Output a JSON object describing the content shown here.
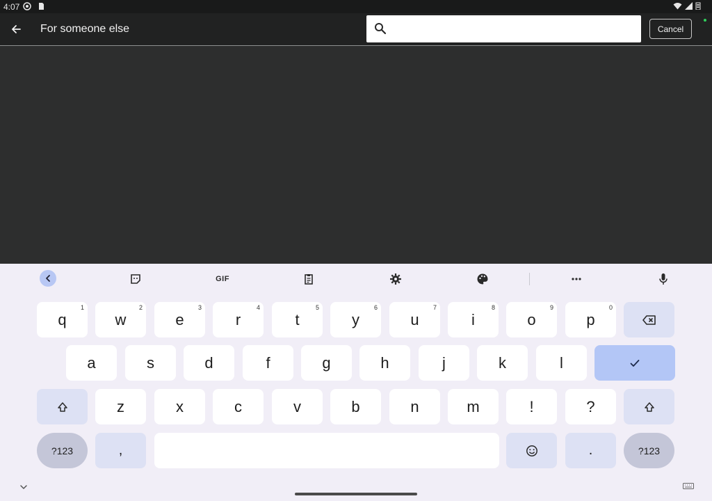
{
  "status_bar": {
    "time": "4:07",
    "icons": [
      "chrome-like-icon",
      "sd-card-icon",
      "wifi-icon",
      "signal-icon",
      "battery-icon"
    ]
  },
  "app_bar": {
    "title": "For someone else",
    "search": {
      "value": "",
      "placeholder": ""
    },
    "cancel_label": "Cancel"
  },
  "keyboard": {
    "toolbar": {
      "icons": [
        "collapse-icon",
        "sticker-icon",
        "gif-icon",
        "clipboard-icon",
        "settings-icon",
        "palette-icon",
        "more-icon",
        "mic-icon"
      ],
      "gif_label": "GIF"
    },
    "row1": [
      {
        "label": "q",
        "hint": "1"
      },
      {
        "label": "w",
        "hint": "2"
      },
      {
        "label": "e",
        "hint": "3"
      },
      {
        "label": "r",
        "hint": "4"
      },
      {
        "label": "t",
        "hint": "5"
      },
      {
        "label": "y",
        "hint": "6"
      },
      {
        "label": "u",
        "hint": "7"
      },
      {
        "label": "i",
        "hint": "8"
      },
      {
        "label": "o",
        "hint": "9"
      },
      {
        "label": "p",
        "hint": "0"
      }
    ],
    "row2": [
      "a",
      "s",
      "d",
      "f",
      "g",
      "h",
      "j",
      "k",
      "l"
    ],
    "row3": [
      "z",
      "x",
      "c",
      "v",
      "b",
      "n",
      "m",
      "!",
      "?"
    ],
    "symbols_label": "?123",
    "comma_label": ",",
    "period_label": "."
  },
  "colors": {
    "accent": "#b3c6f6",
    "keyboard_bg": "#f1eef7",
    "app_bg": "#2d2e2e"
  }
}
